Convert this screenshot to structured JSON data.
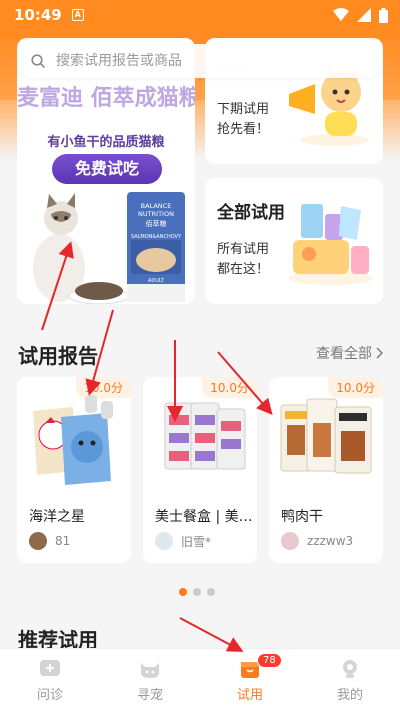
{
  "status_bar": {
    "time": "10:49",
    "app_icon": "A"
  },
  "search": {
    "placeholder": "搜索试用报告或商品"
  },
  "promo": {
    "title": "麦富迪 佰萃成猫粮",
    "subtitle": "有小鱼干的品质猫粮",
    "button": "免费试吃",
    "bag_brand": "BALANCE\nNUTRITION",
    "bag_cn": "佰萃粮",
    "bag_flavor": "SALMON&ANCHOVY",
    "bag_size": "ADULT"
  },
  "cards": [
    {
      "heading": "",
      "desc": "下期试用\n抢先看！"
    },
    {
      "heading": "全部试用",
      "desc": "所有试用\n都在这！"
    }
  ],
  "reports_section": {
    "title": "试用报告",
    "view_all": "查看全部"
  },
  "reports": [
    {
      "price": "10.0分",
      "name": "海洋之星",
      "user": "81"
    },
    {
      "price": "10.0分",
      "name": "美士餐盒 | 美…",
      "user": "旧雪*"
    },
    {
      "price": "10.0分",
      "name": "鸭肉干",
      "user": "zzzww3"
    }
  ],
  "carousel": {
    "active_index": 0,
    "count": 3
  },
  "recommend_section": {
    "title": "推荐试用"
  },
  "tabs": [
    {
      "label": "问诊",
      "icon": "consult-icon",
      "active": false
    },
    {
      "label": "寻宠",
      "icon": "cat-face-icon",
      "active": false
    },
    {
      "label": "试用",
      "icon": "trial-bag-icon",
      "active": true,
      "badge": "78"
    },
    {
      "label": "我的",
      "icon": "profile-icon",
      "active": false
    }
  ],
  "colors": {
    "accent": "#ff7a1a",
    "header": "#ff8a1f",
    "promo_purple": "#5a36b0",
    "annotation_arrow": "#e5262a"
  }
}
